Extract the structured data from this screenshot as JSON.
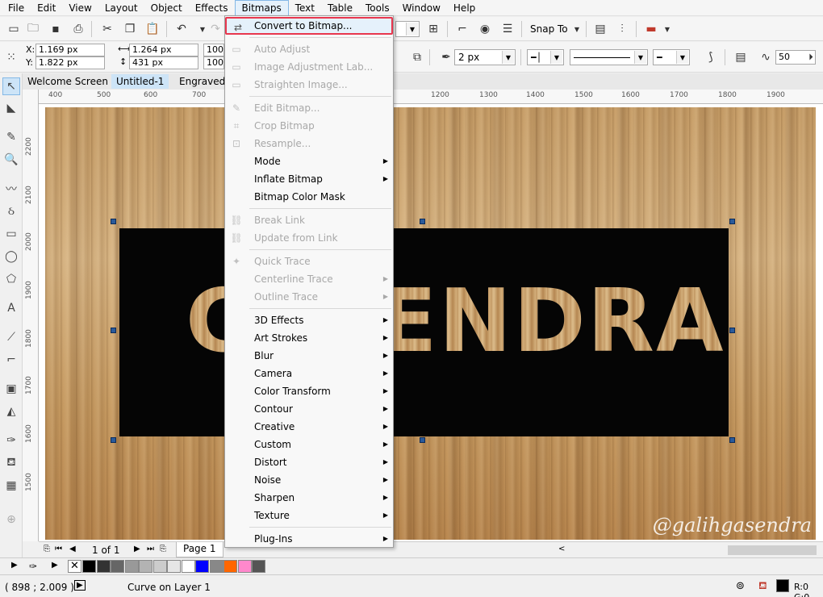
{
  "menubar": [
    "File",
    "Edit",
    "View",
    "Layout",
    "Object",
    "Effects",
    "Bitmaps",
    "Text",
    "Table",
    "Tools",
    "Window",
    "Help"
  ],
  "active_menu": "Bitmaps",
  "toolbar": {
    "snap_to": "Snap To"
  },
  "propbar": {
    "x_label": "X:",
    "x_value": "1.169 px",
    "y_label": "Y:",
    "y_value": "1.822 px",
    "w_value": "1.264 px",
    "h_value": "431 px",
    "scale_w": "100,",
    "scale_h": "100,",
    "outline_width": "2 px",
    "smoothing": "50"
  },
  "doc_tabs": [
    "Welcome Screen",
    "Untitled-1",
    "Engraved E"
  ],
  "ruler_h": [
    "400",
    "500",
    "600",
    "700",
    "1200",
    "1300",
    "1400",
    "1500",
    "1600",
    "1700",
    "1800",
    "1900"
  ],
  "ruler_v": [
    "2200",
    "2100",
    "2000",
    "1900",
    "1800",
    "1700",
    "1600",
    "1500"
  ],
  "canvas": {
    "text_left": "G",
    "text_main": "ENDRA",
    "watermark": "@galihgasendra"
  },
  "bitmaps_menu": {
    "convert": "Convert to Bitmap...",
    "auto_adjust": "Auto Adjust",
    "image_adjustment_lab": "Image Adjustment Lab...",
    "straighten": "Straighten Image...",
    "edit_bitmap": "Edit Bitmap...",
    "crop_bitmap": "Crop Bitmap",
    "resample": "Resample...",
    "mode": "Mode",
    "inflate_bitmap": "Inflate Bitmap",
    "color_mask": "Bitmap Color Mask",
    "break_link": "Break Link",
    "update_from_link": "Update from Link",
    "quick_trace": "Quick Trace",
    "centerline_trace": "Centerline Trace",
    "outline_trace": "Outline Trace",
    "effects_3d": "3D Effects",
    "art_strokes": "Art Strokes",
    "blur": "Blur",
    "camera": "Camera",
    "color_transform": "Color Transform",
    "contour": "Contour",
    "creative": "Creative",
    "custom": "Custom",
    "distort": "Distort",
    "noise": "Noise",
    "sharpen": "Sharpen",
    "texture": "Texture",
    "plugins": "Plug-Ins"
  },
  "pagebar": {
    "page_count": "1 of 1",
    "page_tab": "Page 1"
  },
  "palette_colors": [
    "#000000",
    "#333333",
    "#666666",
    "#999999",
    "#b3b3b3",
    "#cccccc",
    "#e6e6e6",
    "#ffffff",
    "#0000ff",
    "#888888",
    "#ff6600",
    "#ff88cc",
    "#555555"
  ],
  "status": {
    "coords": "( 898  ; 2.009 )",
    "object_info": "Curve on Layer 1",
    "color_info": "R:0 G:0"
  }
}
